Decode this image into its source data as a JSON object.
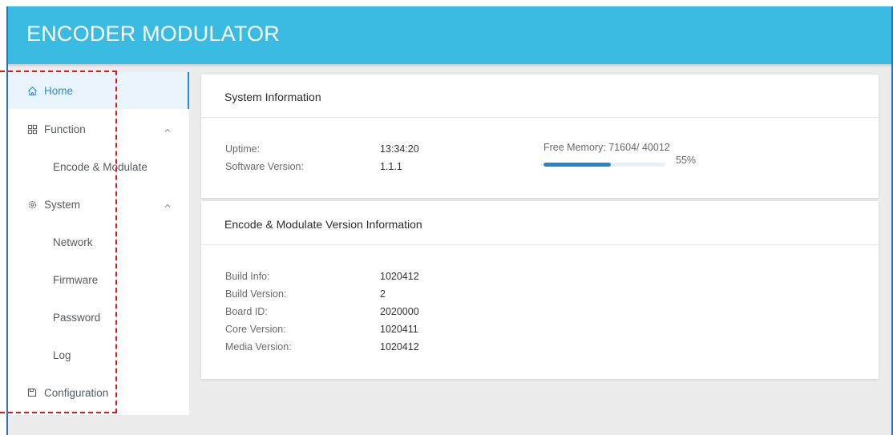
{
  "header": {
    "title": "ENCODER MODULATOR"
  },
  "sidebar": {
    "items": [
      {
        "label": "Home",
        "icon": "home-icon",
        "active": true
      },
      {
        "label": "Function",
        "icon": "grid-icon",
        "caret": "chevron-up-icon"
      },
      {
        "label": "Encode & Modulate"
      },
      {
        "label": "System",
        "icon": "gear-icon",
        "caret": "chevron-up-icon"
      },
      {
        "label": "Network"
      },
      {
        "label": "Firmware"
      },
      {
        "label": "Password"
      },
      {
        "label": "Log"
      },
      {
        "label": "Configuration",
        "icon": "save-icon"
      }
    ]
  },
  "system_info": {
    "title": "System Information",
    "uptime_label": "Uptime:",
    "uptime_value": "13:34:20",
    "software_version_label": "Software Version:",
    "software_version_value": "1.1.1",
    "free_memory_label": "Free Memory: 71604/ 40012",
    "memory_percent_text": "55%",
    "memory_fraction": 0.55
  },
  "version_info": {
    "title": "Encode & Modulate Version Information",
    "rows": [
      {
        "label": "Build Info:",
        "value": "1020412"
      },
      {
        "label": "Build Version:",
        "value": "2"
      },
      {
        "label": "Board ID:",
        "value": "2020000"
      },
      {
        "label": "Core Version:",
        "value": "1020411"
      },
      {
        "label": "Media Version:",
        "value": "1020412"
      }
    ]
  },
  "colors": {
    "header": "#3abbe2",
    "accent": "#2a8bd6",
    "progress": "#1e88d6",
    "annotation": "#e01818",
    "window_frame": "#2f6fb5"
  }
}
